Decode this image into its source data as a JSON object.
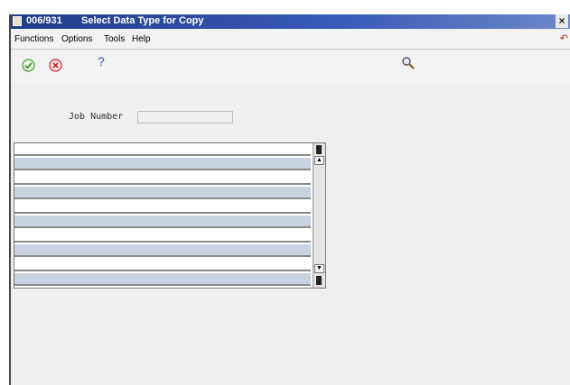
{
  "window": {
    "form_id": "006/931",
    "title": "Select Data Type for Copy",
    "close_glyph": "×"
  },
  "menu": {
    "items": [
      {
        "label": "Functions"
      },
      {
        "label": "Options"
      },
      {
        "label": "Tools"
      },
      {
        "label": "Help"
      }
    ]
  },
  "toolbar": {
    "ok_icon": "checkmark-icon",
    "cancel_icon": "cancel-icon",
    "help_label": "?",
    "search_icon": "magnifier-icon"
  },
  "form": {
    "job_number_label": "Job Number",
    "job_number_value": ""
  },
  "grid": {
    "rows": 10,
    "colors": {
      "alt_row": "#c9d3e0",
      "row": "#ffffff"
    }
  },
  "colors": {
    "titlebar": "#1f3b8a",
    "ok_green": "#3c9a2e",
    "cancel_red": "#c62828"
  }
}
